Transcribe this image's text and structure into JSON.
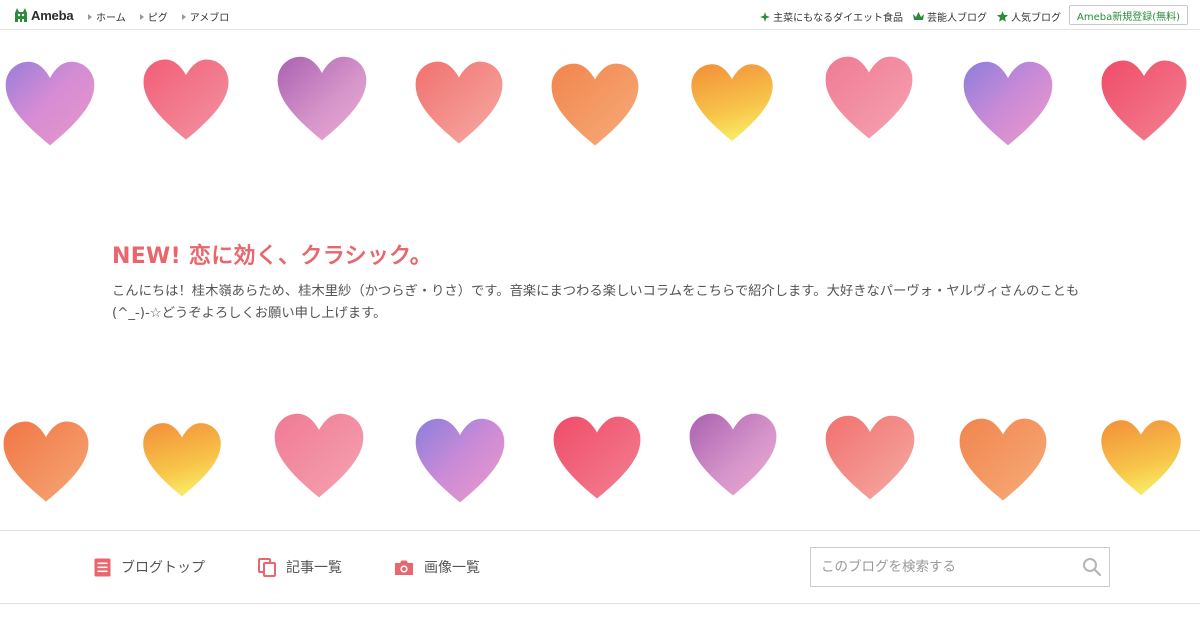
{
  "topbar": {
    "logo_text": "Ameba",
    "left_links": [
      {
        "label": "ホーム"
      },
      {
        "label": "ピグ"
      },
      {
        "label": "アメブロ"
      }
    ],
    "right_links": [
      {
        "label": "主菜にもなるダイエット食品",
        "icon": "sparkle-icon"
      },
      {
        "label": "芸能人ブログ",
        "icon": "crown-icon"
      },
      {
        "label": "人気ブログ",
        "icon": "star-icon"
      }
    ],
    "register_label": "Ameba新規登録(無料)",
    "colors": {
      "accent_green": "#2c8a3c"
    }
  },
  "hero": {
    "title": "NEW! 恋に効く、クラシック。",
    "description": "こんにちは！桂木嶺あらため、桂木里紗（かつらぎ・りさ）です。音楽にまつわる楽しいコラムをこちらで紹介します。大好きなパーヴォ・ヤルヴィさんのことも(^_-)-☆どうぞよろしくお願い申し上げます。",
    "title_color": "#e8666c",
    "hearts_top": [
      "violet-pink",
      "red-pink",
      "purple",
      "coral",
      "orange",
      "yellow-orange",
      "pink-red",
      "violet",
      "crimson"
    ],
    "hearts_bottom": [
      "orange",
      "yellow-orange",
      "pink",
      "violet",
      "crimson",
      "purple",
      "coral",
      "orange-red",
      "yellow-orange"
    ]
  },
  "menu": {
    "items": [
      {
        "label": "ブログトップ",
        "icon": "document-icon"
      },
      {
        "label": "記事一覧",
        "icon": "copy-icon"
      },
      {
        "label": "画像一覧",
        "icon": "camera-icon"
      }
    ],
    "search": {
      "placeholder": "このブログを検索する",
      "value": ""
    },
    "colors": {
      "icon": "#e8666c",
      "border": "#f4d7d7"
    }
  }
}
